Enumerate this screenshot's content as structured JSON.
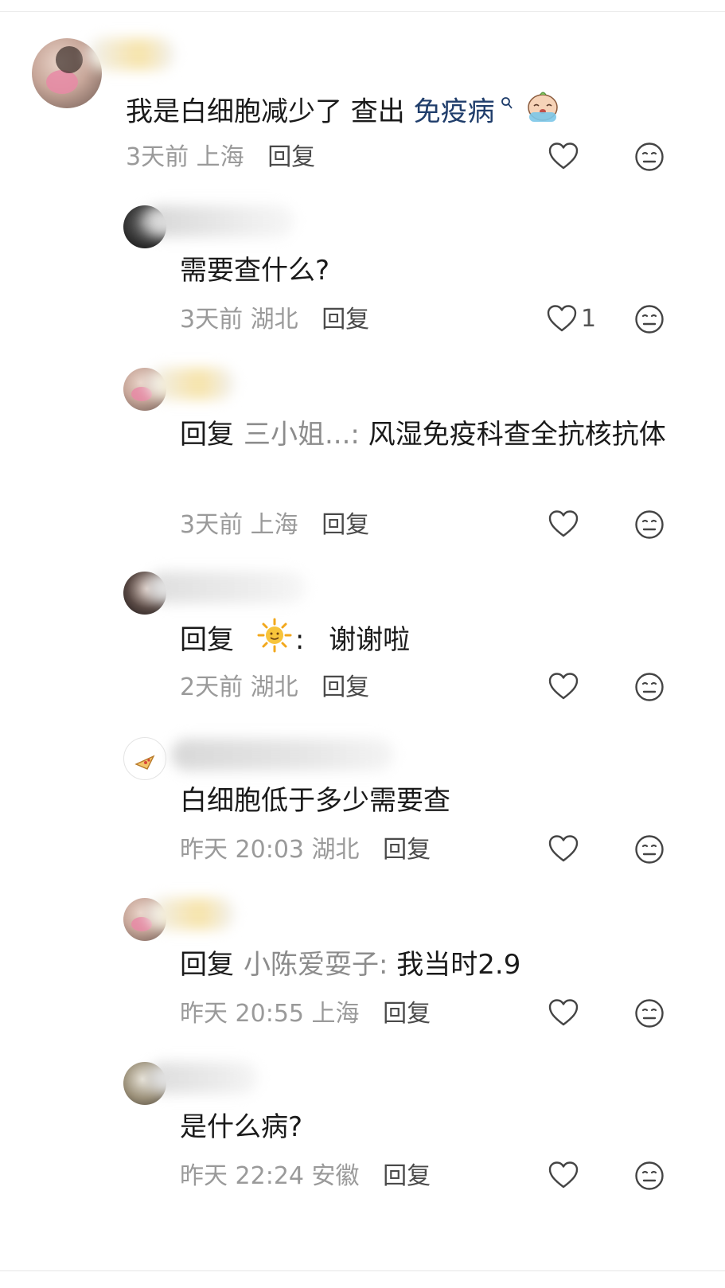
{
  "comments": [
    {
      "text_before": "我是白细胞减少了 查出 ",
      "link": "免疫病",
      "time": "3天前",
      "location": "上海",
      "reply": "回复"
    },
    {
      "text": "需要查什么?",
      "time": "3天前",
      "location": "湖北",
      "reply": "回复",
      "likes": "1"
    },
    {
      "prefix": "回复",
      "target": "三小姐...:",
      "text": "风湿免疫科查全抗核抗体",
      "time": "3天前",
      "location": "上海",
      "reply": "回复"
    },
    {
      "prefix": "回复",
      "target_suffix": ":",
      "text": "谢谢啦",
      "time": "2天前",
      "location": "湖北",
      "reply": "回复"
    },
    {
      "text": "白细胞低于多少需要查",
      "time": "昨天 20:03",
      "location": "湖北",
      "reply": "回复"
    },
    {
      "prefix": "回复",
      "target": "小陈爱耍子:",
      "text": "我当时2.9",
      "time": "昨天 20:55",
      "location": "上海",
      "reply": "回复"
    },
    {
      "text": "是什么病?",
      "time": "昨天 22:24",
      "location": "安徽",
      "reply": "回复"
    }
  ],
  "icons": {
    "like": "heart-outline-icon",
    "dislike": "meh-face-icon",
    "search_hint": "search-icon",
    "emoji_sun": "sun-emoji-icon",
    "emoji_cry": "crying-emoji-icon"
  },
  "colors": {
    "link": "#1f3d6b",
    "meta": "#9a9a9a",
    "reply_target": "#8c8c8c",
    "icon": "#444444"
  }
}
